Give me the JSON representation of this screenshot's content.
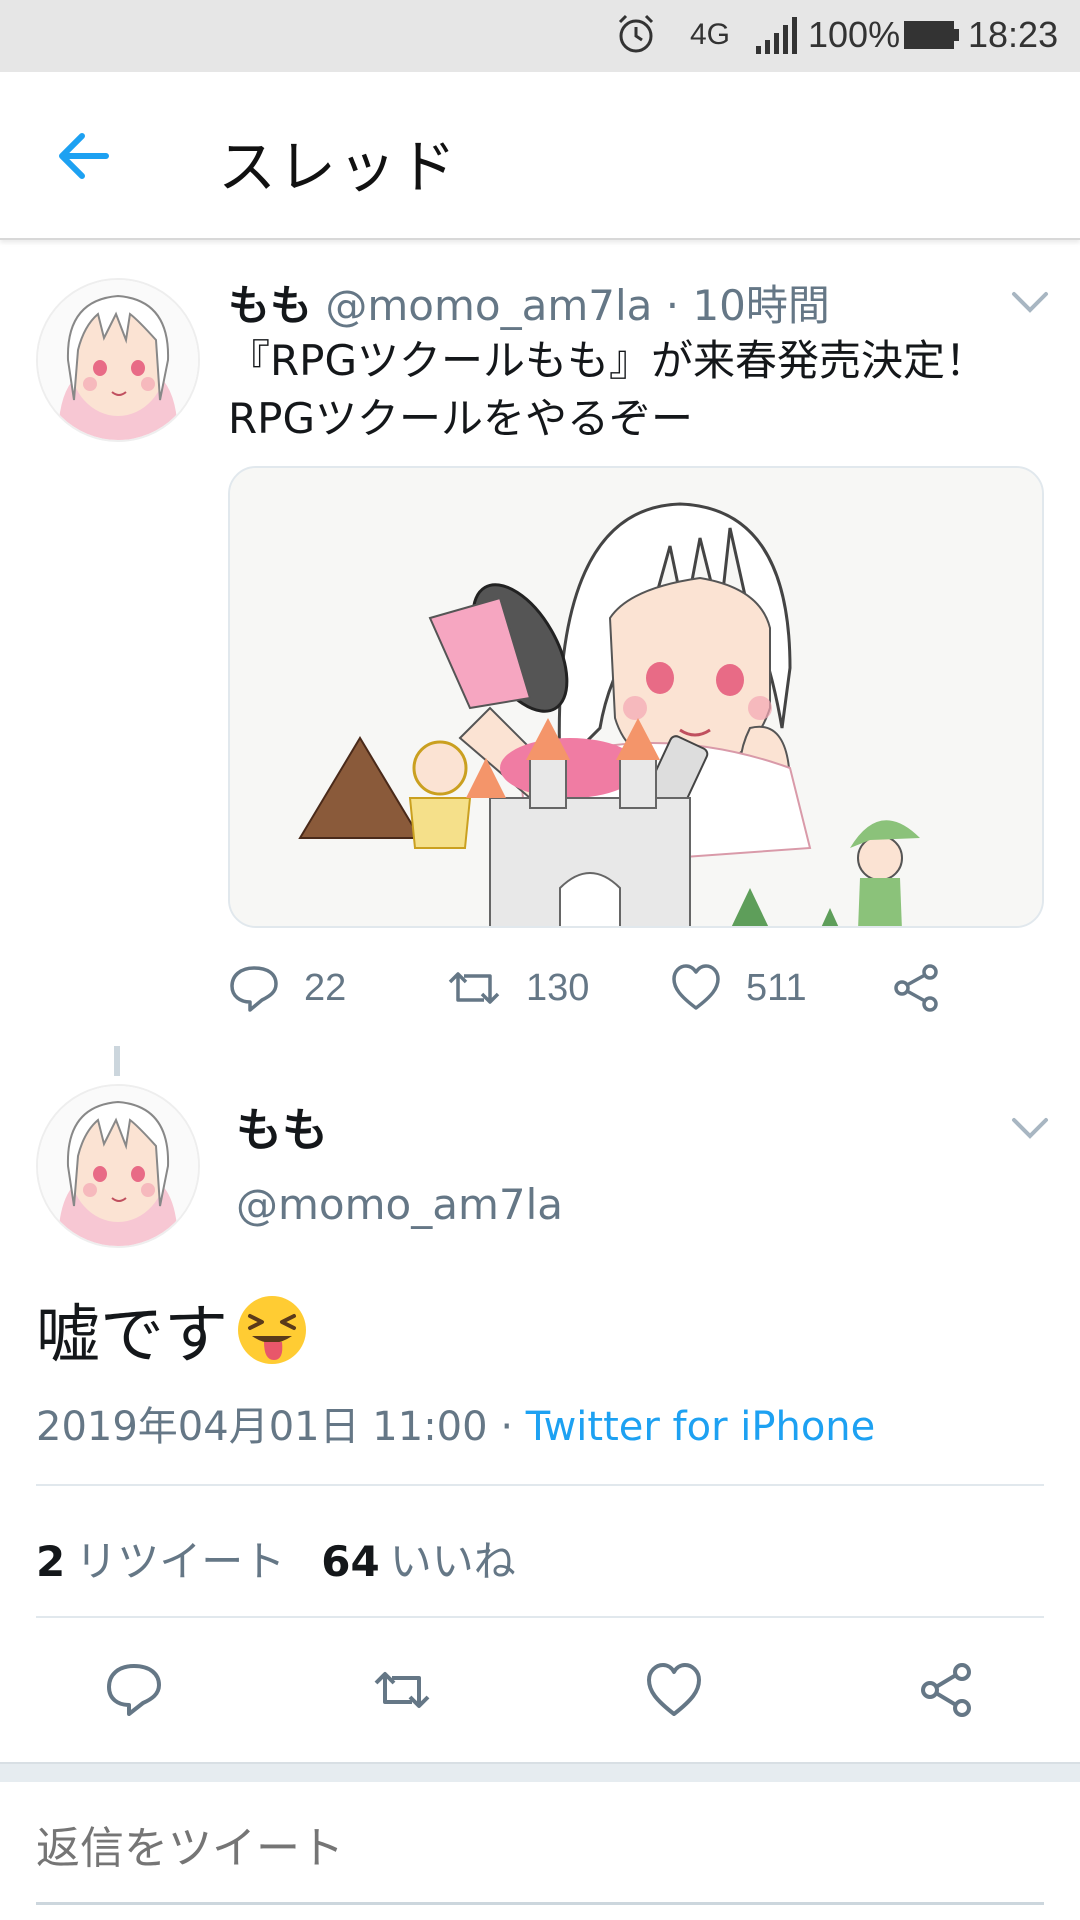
{
  "status_bar": {
    "network": "4G",
    "battery": "100%",
    "time": "18:23",
    "icons": [
      "alarm-icon",
      "signal-icon",
      "battery-icon"
    ]
  },
  "header": {
    "title": "スレッド",
    "back_icon": "back-arrow-icon"
  },
  "parent_tweet": {
    "name": "もも",
    "handle": "@momo_am7la",
    "time_ago": "10時間",
    "separator": "·",
    "text_line1": "『RPGツクールもも』が来春発売決定！",
    "text_line2": "RPGツクールをやるぞー",
    "actions": {
      "reply_count": "22",
      "retweet_count": "130",
      "like_count": "511"
    }
  },
  "main_tweet": {
    "name": "もも",
    "handle": "@momo_am7la",
    "text": "嘘です",
    "emoji": "squinting-face-with-tongue",
    "timestamp": "2019年04月01日 11:00",
    "separator": "·",
    "source": "Twitter for iPhone",
    "retweets": "2",
    "retweets_label": "リツイート",
    "likes": "64",
    "likes_label": "いいね"
  },
  "reply": {
    "placeholder": "返信をツイート"
  },
  "colors": {
    "accent": "#1da1f2",
    "secondary_text": "#657786",
    "divider": "#e1e8ed"
  }
}
